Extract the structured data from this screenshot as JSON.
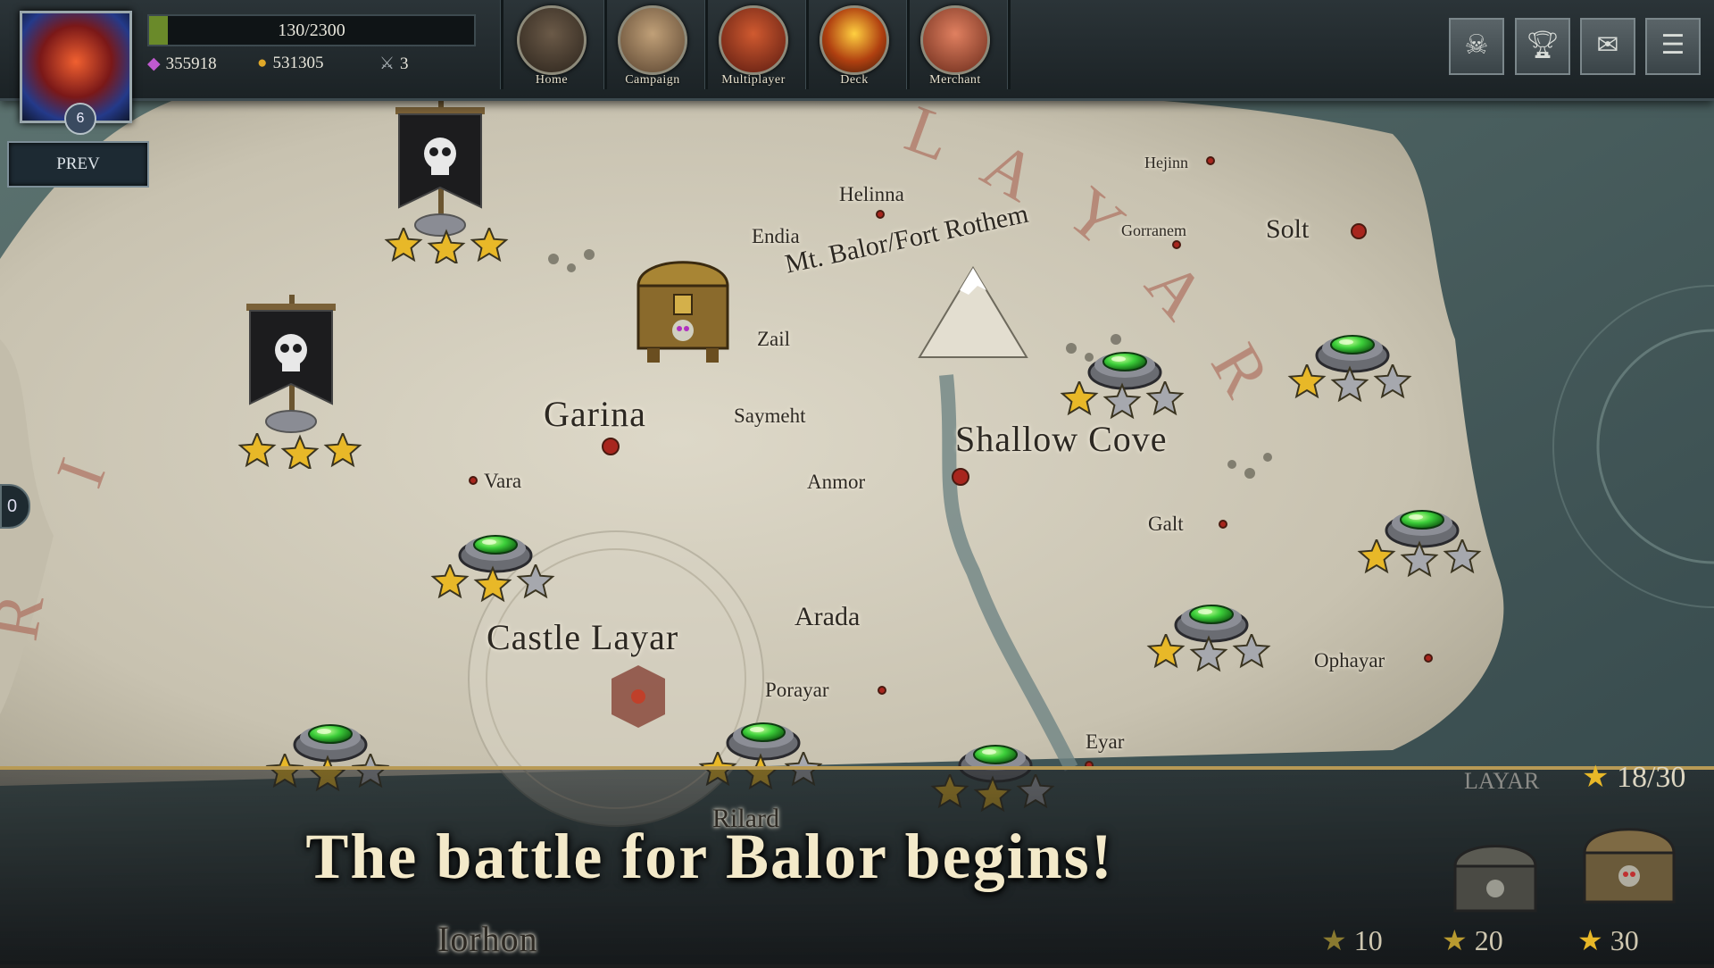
{
  "header": {
    "player_level": "6",
    "xp_text": "130/2300",
    "xp_fraction": 0.0565,
    "gems": "355918",
    "gold": "531305",
    "swords": "3"
  },
  "nav": [
    {
      "label": "Home"
    },
    {
      "label": "Campaign"
    },
    {
      "label": "Multiplayer"
    },
    {
      "label": "Deck"
    },
    {
      "label": "Merchant"
    }
  ],
  "right_buttons": [
    "guild-icon",
    "trophy-icon",
    "mail-icon",
    "menu-icon"
  ],
  "prev_label": "PREV",
  "side_counter": "0",
  "map": {
    "region_watermark": "LAYAR",
    "places": [
      {
        "name": "Helinna"
      },
      {
        "name": "Hejinn"
      },
      {
        "name": "Endia"
      },
      {
        "name": "Gorranem"
      },
      {
        "name": "Solt"
      },
      {
        "name": "Mt. Balor/Fort Rothem"
      },
      {
        "name": "Zail"
      },
      {
        "name": "Garina"
      },
      {
        "name": "Saymeht"
      },
      {
        "name": "Shallow Cove"
      },
      {
        "name": "Vara"
      },
      {
        "name": "Anmor"
      },
      {
        "name": "Galt"
      },
      {
        "name": "Castle Layar"
      },
      {
        "name": "Arada"
      },
      {
        "name": "Ophayar"
      },
      {
        "name": "Porayar"
      },
      {
        "name": "Eyar"
      },
      {
        "name": "Rilard"
      },
      {
        "name": "Iorhon"
      }
    ],
    "nodes": [
      {
        "type": "banner",
        "stars": 3
      },
      {
        "type": "banner",
        "stars": 3
      },
      {
        "type": "gem",
        "stars": 1
      },
      {
        "type": "gem",
        "stars": 1
      },
      {
        "type": "gem",
        "stars": 2
      },
      {
        "type": "gem",
        "stars": 1
      },
      {
        "type": "gem",
        "stars": 1
      },
      {
        "type": "gem",
        "stars": 2
      },
      {
        "type": "gem",
        "stars": 2
      },
      {
        "type": "gem",
        "stars": 2
      }
    ]
  },
  "tagline": "The battle for Balor begins!",
  "footer": {
    "region": "LAYAR",
    "progress": "18/30",
    "rewards": [
      "10",
      "20",
      "30"
    ]
  },
  "colors": {
    "gold": "#e8b828",
    "gem": "#3ccf3a",
    "parchment": "#d9d3c2",
    "accent": "#b89a55"
  }
}
